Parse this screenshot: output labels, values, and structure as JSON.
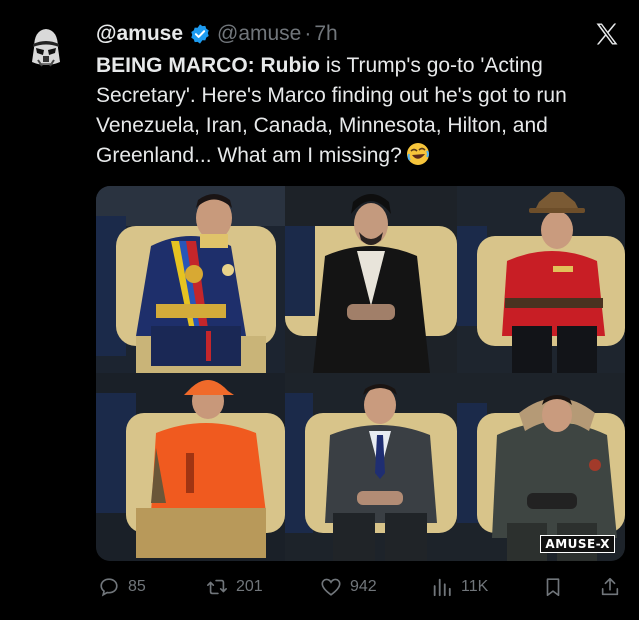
{
  "author": {
    "display_name": "@amuse",
    "handle": "@amuse",
    "separator": "·",
    "time": "7h"
  },
  "tweet": {
    "prefix_bold": "BEING MARCO:",
    "name_bold": "Rubio",
    "text_rest": " is Trump's go-to 'Acting Secretary'. Here's Marco finding out he's got to run Venezuela, Iran, Canada, Minnesota, Hilton, and Greenland... What am I missing?"
  },
  "media": {
    "watermark": "AMUSE-X",
    "panels": [
      "venezuela-uniform",
      "cleric-robe",
      "mountie-uniform",
      "hunter-vest",
      "suit",
      "parka"
    ]
  },
  "actions": {
    "replies": "85",
    "retweets": "201",
    "likes": "942",
    "views": "11K"
  },
  "colors": {
    "background": "#000000",
    "text": "#e7e9ea",
    "muted": "#71767b",
    "verified": "#1d9bf0"
  },
  "icons": [
    "stormtrooper-avatar",
    "verified-badge-icon",
    "x-logo-icon",
    "rofl-emoji",
    "reply-icon",
    "retweet-icon",
    "like-icon",
    "views-icon",
    "bookmark-icon",
    "share-icon"
  ]
}
